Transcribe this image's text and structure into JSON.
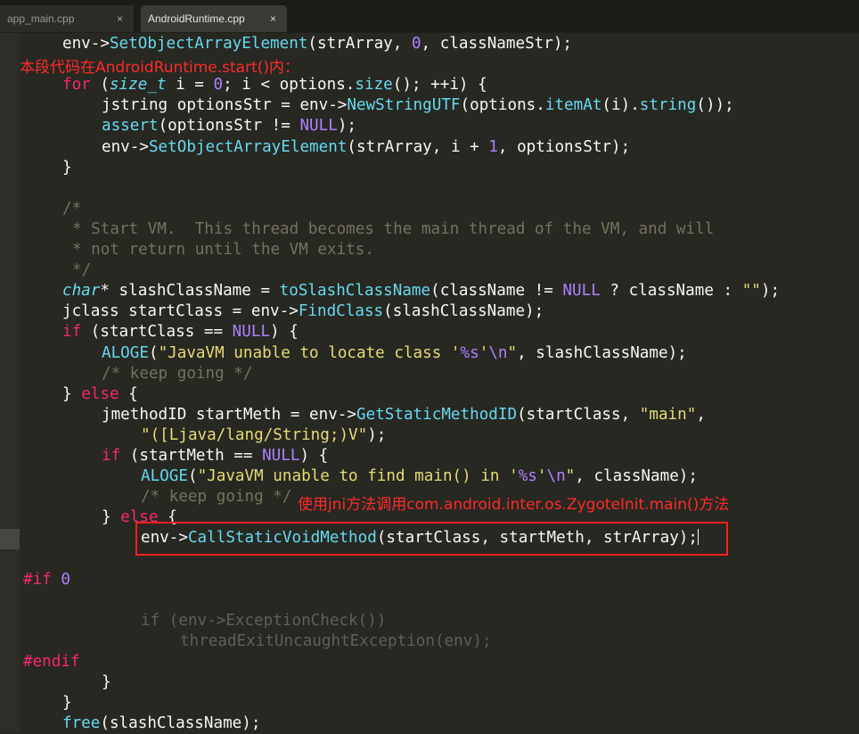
{
  "tabs": [
    {
      "label": "app_main.cpp",
      "close": "×"
    },
    {
      "label": "AndroidRuntime.cpp",
      "close": "×"
    }
  ],
  "annotations": {
    "top_note": "本段代码在AndroidRuntime.start()内：",
    "side_note": "使用jni方法调用com.android.inter.os.ZygoteInit.main()方法"
  },
  "code_lines": [
    {
      "indent": 4,
      "tokens": [
        {
          "t": "env->"
        },
        {
          "t": "SetObjectArrayElement",
          "c": "f"
        },
        {
          "t": "(strArray, "
        },
        {
          "t": "0",
          "c": "n"
        },
        {
          "t": ", classNameStr);"
        }
      ]
    },
    {
      "indent": 4,
      "tokens": []
    },
    {
      "indent": 4,
      "tokens": [
        {
          "t": "for",
          "c": "k"
        },
        {
          "t": " ("
        },
        {
          "t": "size_t",
          "c": "t"
        },
        {
          "t": " i = "
        },
        {
          "t": "0",
          "c": "n"
        },
        {
          "t": "; i < options."
        },
        {
          "t": "size",
          "c": "f"
        },
        {
          "t": "(); ++i) {"
        }
      ]
    },
    {
      "indent": 8,
      "tokens": [
        {
          "t": "jstring optionsStr = env->"
        },
        {
          "t": "NewStringUTF",
          "c": "f"
        },
        {
          "t": "(options."
        },
        {
          "t": "itemAt",
          "c": "f"
        },
        {
          "t": "(i)."
        },
        {
          "t": "string",
          "c": "f"
        },
        {
          "t": "());"
        }
      ]
    },
    {
      "indent": 8,
      "tokens": [
        {
          "t": "assert",
          "c": "f"
        },
        {
          "t": "(optionsStr != "
        },
        {
          "t": "NULL",
          "c": "n"
        },
        {
          "t": ");"
        }
      ]
    },
    {
      "indent": 8,
      "tokens": [
        {
          "t": "env->"
        },
        {
          "t": "SetObjectArrayElement",
          "c": "f"
        },
        {
          "t": "(strArray, i + "
        },
        {
          "t": "1",
          "c": "n"
        },
        {
          "t": ", optionsStr);"
        }
      ]
    },
    {
      "indent": 4,
      "tokens": [
        {
          "t": "}"
        }
      ]
    },
    {
      "indent": 0,
      "tokens": []
    },
    {
      "indent": 4,
      "tokens": [
        {
          "t": "/*",
          "c": "c"
        }
      ]
    },
    {
      "indent": 5,
      "tokens": [
        {
          "t": "* Start VM.  This thread becomes the main thread of the VM, and will",
          "c": "c"
        }
      ]
    },
    {
      "indent": 5,
      "tokens": [
        {
          "t": "* not return until the VM exits.",
          "c": "c"
        }
      ]
    },
    {
      "indent": 5,
      "tokens": [
        {
          "t": "*/",
          "c": "c"
        }
      ]
    },
    {
      "indent": 4,
      "tokens": [
        {
          "t": "char",
          "c": "t"
        },
        {
          "t": "* slashClassName = "
        },
        {
          "t": "toSlashClassName",
          "c": "f"
        },
        {
          "t": "(className != "
        },
        {
          "t": "NULL",
          "c": "n"
        },
        {
          "t": " ? className : "
        },
        {
          "t": "\"\"",
          "c": "s"
        },
        {
          "t": ");"
        }
      ]
    },
    {
      "indent": 4,
      "tokens": [
        {
          "t": "jclass startClass = env->"
        },
        {
          "t": "FindClass",
          "c": "f"
        },
        {
          "t": "(slashClassName);"
        }
      ]
    },
    {
      "indent": 4,
      "tokens": [
        {
          "t": "if",
          "c": "k"
        },
        {
          "t": " (startClass == "
        },
        {
          "t": "NULL",
          "c": "n"
        },
        {
          "t": ") {"
        }
      ]
    },
    {
      "indent": 8,
      "tokens": [
        {
          "t": "ALOGE",
          "c": "f"
        },
        {
          "t": "("
        },
        {
          "t": "\"JavaVM unable to locate class '",
          "c": "s"
        },
        {
          "t": "%s",
          "c": "n"
        },
        {
          "t": "'",
          "c": "s"
        },
        {
          "t": "\\n",
          "c": "n"
        },
        {
          "t": "\"",
          "c": "s"
        },
        {
          "t": ", slashClassName);"
        }
      ]
    },
    {
      "indent": 8,
      "tokens": [
        {
          "t": "/* keep going */",
          "c": "c"
        }
      ]
    },
    {
      "indent": 4,
      "tokens": [
        {
          "t": "} "
        },
        {
          "t": "else",
          "c": "k"
        },
        {
          "t": " {"
        }
      ]
    },
    {
      "indent": 8,
      "tokens": [
        {
          "t": "jmethodID startMeth = env->"
        },
        {
          "t": "GetStaticMethodID",
          "c": "f"
        },
        {
          "t": "(startClass, "
        },
        {
          "t": "\"main\"",
          "c": "s"
        },
        {
          "t": ","
        }
      ]
    },
    {
      "indent": 12,
      "tokens": [
        {
          "t": "\"([Ljava/lang/String;)V\"",
          "c": "s"
        },
        {
          "t": ");"
        }
      ]
    },
    {
      "indent": 8,
      "tokens": [
        {
          "t": "if",
          "c": "k"
        },
        {
          "t": " (startMeth == "
        },
        {
          "t": "NULL",
          "c": "n"
        },
        {
          "t": ") {"
        }
      ]
    },
    {
      "indent": 12,
      "tokens": [
        {
          "t": "ALOGE",
          "c": "f"
        },
        {
          "t": "("
        },
        {
          "t": "\"JavaVM unable to find main() in '",
          "c": "s"
        },
        {
          "t": "%s",
          "c": "n"
        },
        {
          "t": "'",
          "c": "s"
        },
        {
          "t": "\\n",
          "c": "n"
        },
        {
          "t": "\"",
          "c": "s"
        },
        {
          "t": ", className);"
        }
      ]
    },
    {
      "indent": 12,
      "tokens": [
        {
          "t": "/* keep going */",
          "c": "c"
        }
      ]
    },
    {
      "indent": 8,
      "tokens": [
        {
          "t": "} "
        },
        {
          "t": "else",
          "c": "k"
        },
        {
          "t": " {"
        }
      ]
    },
    {
      "indent": 12,
      "tokens": [
        {
          "t": "env->"
        },
        {
          "t": "CallStaticVoidMethod",
          "c": "f"
        },
        {
          "t": "(startClass, startMeth, strArray);"
        },
        {
          "cursor": true
        }
      ]
    },
    {
      "indent": 0,
      "tokens": []
    },
    {
      "indent": 0,
      "tokens": [
        {
          "t": "#if",
          "c": "pp"
        },
        {
          "t": " "
        },
        {
          "t": "0",
          "c": "n"
        }
      ]
    },
    {
      "indent": 0,
      "tokens": []
    },
    {
      "indent": 12,
      "tokens": [
        {
          "t": "if (env->ExceptionCheck())",
          "c": "dim"
        }
      ]
    },
    {
      "indent": 16,
      "tokens": [
        {
          "t": "threadExitUncaughtException(env);",
          "c": "dim"
        }
      ]
    },
    {
      "indent": 0,
      "tokens": [
        {
          "t": "#endif",
          "c": "pp"
        }
      ]
    },
    {
      "indent": 8,
      "tokens": [
        {
          "t": "}"
        }
      ]
    },
    {
      "indent": 4,
      "tokens": [
        {
          "t": "}"
        }
      ]
    },
    {
      "indent": 4,
      "tokens": [
        {
          "t": "free",
          "c": "f"
        },
        {
          "t": "(slashClassName);"
        }
      ]
    }
  ]
}
